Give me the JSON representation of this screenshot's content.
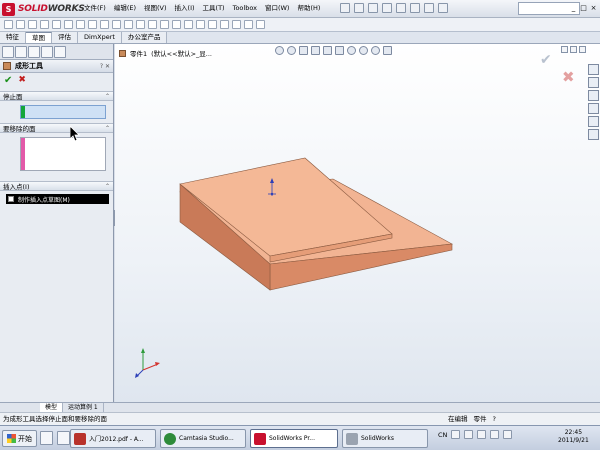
{
  "app": {
    "logo_mark": "S",
    "logo_text_a": "SOLID",
    "logo_text_b": "WORKS",
    "menu": [
      "文件(F)",
      "编辑(E)",
      "视图(V)",
      "插入(I)",
      "工具(T)",
      "Toolbox",
      "窗口(W)",
      "帮助(H)"
    ],
    "window_controls": [
      "_",
      "□",
      "×"
    ]
  },
  "command_tabs": [
    "特征",
    "草图",
    "评估",
    "DimXpert",
    "办公室产品"
  ],
  "active_tab": 1,
  "property_manager": {
    "title": "成形工具",
    "tools": "? ✕",
    "ok": "✔",
    "cancel": "✖",
    "sections": {
      "stop_face": "停止面",
      "faces_to_remove": "要移除的面",
      "insertion_point": "插入点(I)",
      "insert_sketch_label": "制作插入点草图(M)"
    }
  },
  "viewport": {
    "tree_crumb_part": "零件1",
    "tree_crumb_config": "(默认<<默认>_显...",
    "confirm_ok": "✔",
    "confirm_cancel": "✖",
    "colors": {
      "part_top": "#f2b493",
      "part_front": "#d98a66",
      "part_side": "#c97a58",
      "axis_x": "#d3342f",
      "axis_y": "#2e9b3c",
      "axis_z": "#2c3fb8"
    }
  },
  "status_tabs": [
    "模型",
    "运动算例 1"
  ],
  "statusbar": {
    "message": "为成形工具选择停止面和要移除的面",
    "mode": "在编辑",
    "doc": "零件",
    "icon": "?"
  },
  "taskbar": {
    "start": "开始",
    "tasks": [
      {
        "label": "入门2012.pdf - A...",
        "color": "#b8322b"
      },
      {
        "label": "Camtasia Studio...",
        "color": "#2e8b3a"
      },
      {
        "label": "SolidWorks Pr...",
        "color": "#c8102e"
      },
      {
        "label": "SolidWorks",
        "color": "#9aa3b0"
      }
    ],
    "lang": "CN",
    "time": "22:45",
    "date": "2011/9/21"
  }
}
